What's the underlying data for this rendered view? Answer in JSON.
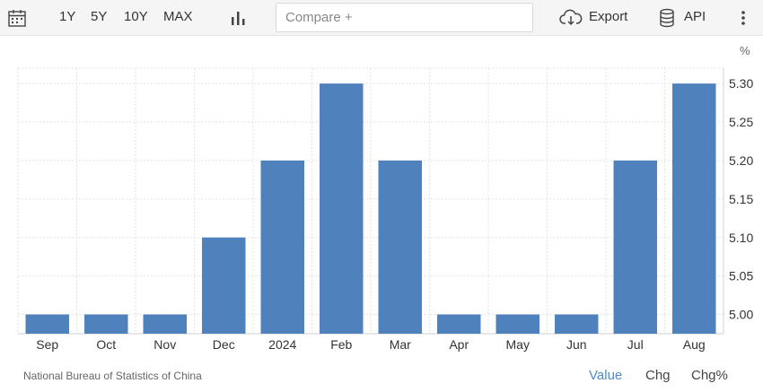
{
  "toolbar": {
    "ranges": [
      "1Y",
      "5Y",
      "10Y",
      "MAX"
    ],
    "compare_placeholder": "Compare +",
    "export_label": "Export",
    "api_label": "API",
    "icons": [
      "calendar-icon",
      "bar-chart-icon",
      "cloud-download-icon",
      "database-icon",
      "more-vertical-icon"
    ]
  },
  "chart_data": {
    "type": "bar",
    "categories": [
      "Sep",
      "Oct",
      "Nov",
      "Dec",
      "2024",
      "Feb",
      "Mar",
      "Apr",
      "May",
      "Jun",
      "Jul",
      "Aug"
    ],
    "values": [
      5.0,
      5.0,
      5.0,
      5.1,
      5.2,
      5.3,
      5.2,
      5.0,
      5.0,
      5.0,
      5.2,
      5.3
    ],
    "yticks": [
      "5.00",
      "5.05",
      "5.10",
      "5.15",
      "5.20",
      "5.25",
      "5.30"
    ],
    "ylim": [
      4.975,
      5.32
    ],
    "unit": "%",
    "grid": true,
    "y_axis_side": "right",
    "bar_color": "#4f81bd"
  },
  "footer": {
    "source": "National Bureau of Statistics of China",
    "modes": [
      "Value",
      "Chg",
      "Chg%"
    ],
    "active_mode": "Value",
    "active_color": "#4f8bc9"
  }
}
